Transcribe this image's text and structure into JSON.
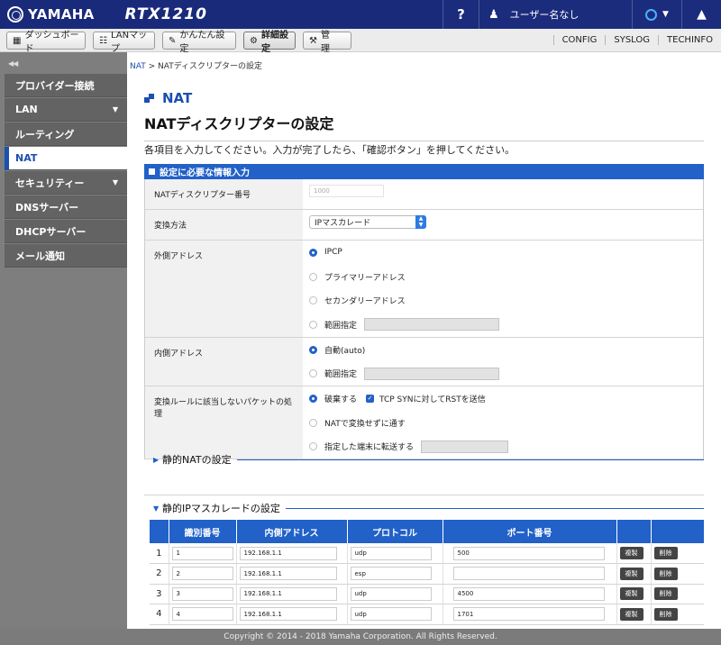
{
  "header": {
    "brand": "YAMAHA",
    "model": "RTX1210",
    "help_label": "?",
    "user_label": "ユーザー名なし"
  },
  "tabs": [
    {
      "label": "ダッシュボード",
      "icon": "dashboard-icon"
    },
    {
      "label": "LANマップ",
      "icon": "lan-map-icon"
    },
    {
      "label": "かんたん設定",
      "icon": "wizard-icon"
    },
    {
      "label": "詳細設定",
      "icon": "gear-icon",
      "active": true
    },
    {
      "label": "管　理",
      "icon": "wrench-icon"
    }
  ],
  "top_links": [
    "CONFIG",
    "SYSLOG",
    "TECHINFO"
  ],
  "sidebar": {
    "items": [
      {
        "label": "プロバイダー接続"
      },
      {
        "label": "LAN",
        "has_arrow": true
      },
      {
        "label": "ルーティング"
      },
      {
        "label": "NAT",
        "active": true
      },
      {
        "label": "セキュリティー",
        "has_arrow": true
      },
      {
        "label": "DNSサーバー"
      },
      {
        "label": "DHCPサーバー"
      },
      {
        "label": "メール通知"
      }
    ]
  },
  "breadcrumb": {
    "link": "NAT",
    "separator": ">",
    "current": "NATディスクリプターの設定"
  },
  "page": {
    "title": "NAT",
    "subtitle": "NATディスクリプターの設定",
    "description": "各項目を入力してください。入力が完了したら、「確認ボタン」を押してください。"
  },
  "required_section": {
    "title": "設定に必要な情報入力",
    "descriptor_label": "NATディスクリプター番号",
    "descriptor_value": "1000",
    "method_label": "変換方法",
    "method_value": "IPマスカレード",
    "outer_label": "外側アドレス",
    "outer_options": [
      "IPCP",
      "プライマリーアドレス",
      "セカンダリーアドレス",
      "範囲指定"
    ],
    "outer_selected": 0,
    "inner_label": "内側アドレス",
    "inner_options": [
      "自動(auto)",
      "範囲指定"
    ],
    "inner_selected": 0,
    "packet_label": "変換ルールに該当しないパケットの処理",
    "packet_options": [
      "破棄する",
      "NATで変換せずに通す",
      "指定した端末に転送する"
    ],
    "packet_selected": 0,
    "tcp_syn_label": "TCP SYNに対してRSTを送信",
    "tcp_syn_checked": true
  },
  "static_nat": {
    "title": "静的NATの設定"
  },
  "static_masq": {
    "title": "静的IPマスカレードの設定",
    "columns": [
      "識別番号",
      "内側アドレス",
      "プロトコル",
      "ポート番号"
    ],
    "rows": [
      {
        "n": "1",
        "id": "1",
        "addr": "192.168.1.1",
        "proto": "udp",
        "port": "500"
      },
      {
        "n": "2",
        "id": "2",
        "addr": "192.168.1.1",
        "proto": "esp",
        "port": ""
      },
      {
        "n": "3",
        "id": "3",
        "addr": "192.168.1.1",
        "proto": "udp",
        "port": "4500"
      },
      {
        "n": "4",
        "id": "4",
        "addr": "192.168.1.1",
        "proto": "udp",
        "port": "1701"
      }
    ],
    "copy_label": "複製",
    "delete_label": "削除"
  },
  "footer": {
    "text": "Copyright © 2014 - 2018 Yamaha Corporation. All Rights Reserved."
  }
}
